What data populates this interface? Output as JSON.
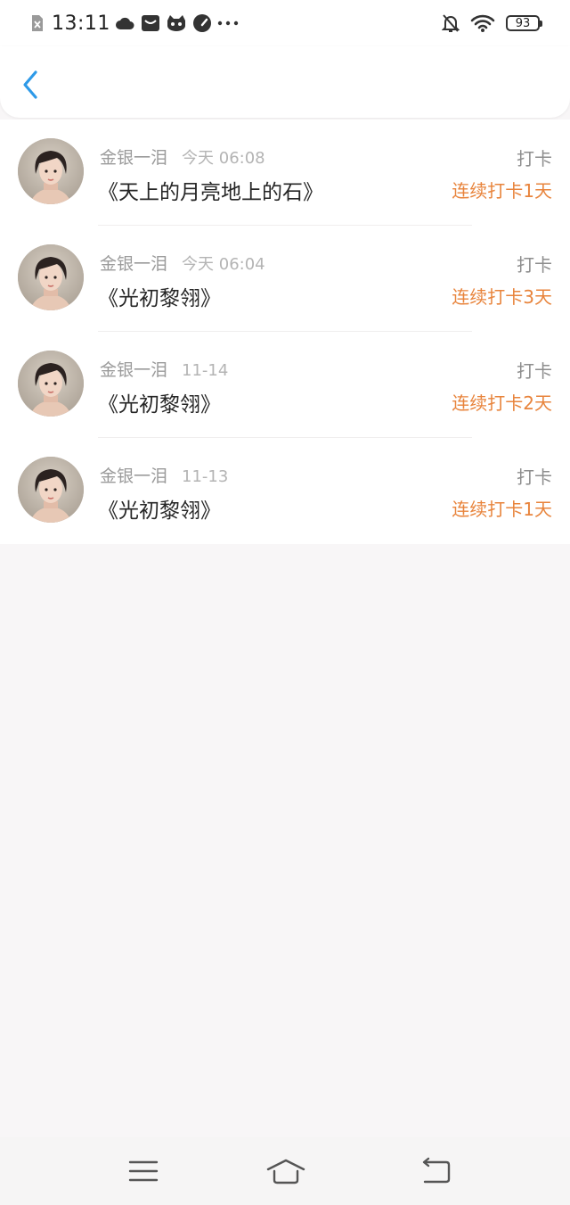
{
  "status": {
    "time": "13:11",
    "battery": "93",
    "icons": [
      "sim-off-icon",
      "cloud-icon",
      "mail-icon",
      "cat-icon",
      "speed-icon",
      "more-dots-icon",
      "bell-off-icon",
      "wifi-icon",
      "battery-icon"
    ]
  },
  "header": {
    "back_icon": "chevron-left-icon",
    "accent": "#2e9ae8"
  },
  "items": [
    {
      "user": "金银一泪",
      "time": "今天 06:08",
      "title": "《天上的月亮地上的石》",
      "action": "打卡",
      "streak": "连续打卡1天"
    },
    {
      "user": "金银一泪",
      "time": "今天 06:04",
      "title": "《光初黎翎》",
      "action": "打卡",
      "streak": "连续打卡3天"
    },
    {
      "user": "金银一泪",
      "time": "11-14",
      "title": "《光初黎翎》",
      "action": "打卡",
      "streak": "连续打卡2天"
    },
    {
      "user": "金银一泪",
      "time": "11-13",
      "title": "《光初黎翎》",
      "action": "打卡",
      "streak": "连续打卡1天"
    }
  ],
  "colors": {
    "streak": "#e8843c",
    "background": "#f8f6f7"
  },
  "nav": {
    "icons": [
      "menu-icon",
      "home-icon",
      "back-icon"
    ]
  }
}
